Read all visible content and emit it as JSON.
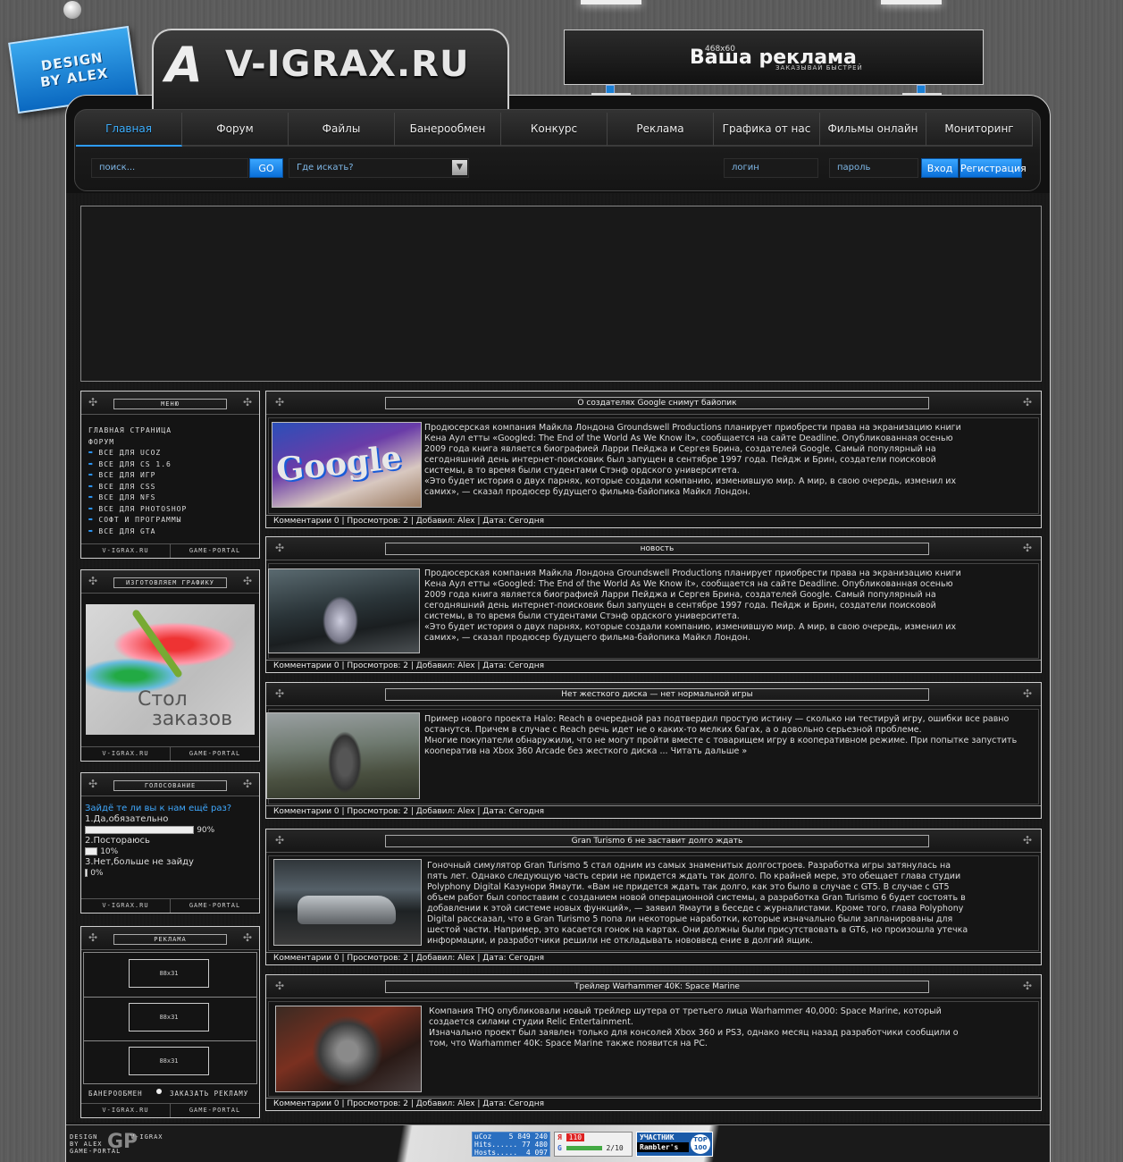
{
  "badge": {
    "line1": "DESIGN",
    "line2": "BY ALEX"
  },
  "logo": {
    "mark": "A",
    "text": "V-IGRAX.RU"
  },
  "top_ad": {
    "size": "468x60",
    "title": "Ваша реклама",
    "subtitle": "ЗАКАЗЫВАЙ БЫСТРЕЙ"
  },
  "nav": [
    "Главная",
    "Форум",
    "Файлы",
    "Банерообмен",
    "Конкурс",
    "Реклама",
    "Графика от нас",
    "Фильмы онлайн",
    "Мониторинг"
  ],
  "search": {
    "placeholder": "поиск...",
    "go": "GO",
    "where": "Где искать?"
  },
  "auth": {
    "login": "логин",
    "password": "пароль",
    "enter": "Вход",
    "register": "Регистрация"
  },
  "sidebar": {
    "footer_left": "V-IGRAX.RU",
    "footer_right": "GAME-PORTAL",
    "menu": {
      "title": "меню",
      "items": [
        "главная страница",
        "форум"
      ],
      "sub": [
        "все для ucoz",
        "все для cs 1.6",
        "все для игр",
        "все для css",
        "все для nfs",
        "все для photoshop",
        "софт и программы",
        "все для gta"
      ]
    },
    "graphics": {
      "title": "изготовляем графику",
      "image_text_1": "Стол",
      "image_text_2": "заказов"
    },
    "poll": {
      "title": "голосование",
      "question": "Зайдё те ли вы к нам ещё раз?",
      "options": [
        {
          "label": "1.Да,обязательно",
          "pct": "90%",
          "value": 90
        },
        {
          "label": "2.Постораюсь",
          "pct": "10%",
          "value": 10
        },
        {
          "label": "3.Нет,больше не зайду",
          "pct": "0%",
          "value": 0
        }
      ]
    },
    "ads": {
      "title": "реклама",
      "slots": [
        "88x31",
        "88x31",
        "88x31"
      ],
      "bottom_left": "Банерообмен",
      "bottom_right": "Заказать рекламу"
    }
  },
  "news": [
    {
      "title": "О создателях Google снимут байопик",
      "text": "Продюсерская компания Майкла Лондона Groundswell Productions планирует приобрести права на экранизацию книги Кена Аул етты «Googled: The End of the World As We Know it», сообщается на сайте Deadline. Опубликованная осенью 2009 года книга является биографией Ларри Пейджа и Сергея Брина, создателей Google. Самый популярный на сегодняшний день интернет-поисковик был запущен в сентябре 1997 года. Пейдж и Брин, создатели поисковой системы, в то время были студентами Стэнф ордского университета.\n«Это будет история о двух парнях, которые создали компанию, изменившую мир. А мир, в свою очередь, изменил их самих», — сказал продюсер будущего фильма-байопика Майкл Лондон.",
      "meta": "Комментарии 0 | Просмотров: 2 | Добавил: Alex | Дата: Сегодня",
      "img": "Google"
    },
    {
      "title": "новость",
      "text": "Продюсерская компания Майкла Лондона Groundswell Productions планирует приобрести права на экранизацию книги Кена Аул етты «Googled: The End of the World As We Know it», сообщается на сайте Deadline. Опубликованная осенью 2009 года книга является биографией Ларри Пейджа и Сергея Брина, создателей Google. Самый популярный на сегодняшний день интернет-поисковик был запущен в сентябре 1997 года. Пейдж и Брин, создатели поисковой системы, в то время были студентами Стэнф ордского университета.\n«Это будет история о двух парнях, которые создали компанию, изменившую мир. А мир, в свою очередь, изменил их самих», — сказал продюсер будущего фильма-байопика Майкл Лондон.",
      "meta": "Комментарии 0 | Просмотров: 2 | Добавил: Alex | Дата: Сегодня",
      "img": ""
    },
    {
      "title": "Нет жесткого диска — нет нормальной игры",
      "text": "Пример нового проекта Halo: Reach в очередной раз подтвердил простую истину — сколько ни тестируй игру, ошибки все равно останутся. Причем в случае с Reach речь идет не о каких-то мелких багах, а о довольно серьезной проблеме.\nМногие покупатели обнаружили, что не могут пройти вместе с товарищем игру в кооперативном режиме. При попытке запустить кооператив на Xbox 360 Arcade без жесткого диска ... Читать дальше »",
      "meta": "Комментарии 0 | Просмотров: 2 | Добавил: Alex | Дата: Сегодня",
      "img": ""
    },
    {
      "title": "Gran Turismo 6 не заставит долго ждать",
      "text": "Гоночный симулятор Gran Turismo 5 стал одним из самых знаменитых долгостроев. Разработка игры затянулась на пять лет. Однако следующую часть серии не придется ждать так долго. По крайней мере, это обещает глава студии Polyphony Digital Казунори Ямаути. «Вам не придется ждать так долго, как это было в случае с GT5. В случае с GT5 объем работ был сопоставим с созданием новой операционной системы, а разработка Gran Turismo 6 будет состоять в добавлении к этой системе новых функций», — заявил Ямаути в беседе с журналистами. Кроме того, глава Polyphony Digital рассказал, что в Gran Turismo 5 попа ли некоторые наработки, которые изначально были запланированы для шестой части. Например, это касается гонок на картах. Они должны были присутствовать в GT6, но произошла утечка информации, и разработчики решили не откладывать нововвед ение в долгий ящик.",
      "meta": "Комментарии 0 | Просмотров: 2 | Добавил: Alex | Дата: Сегодня",
      "img": ""
    },
    {
      "title": "Трейлер Warhammer 40K: Space Marine",
      "text": "Компания THQ опубликовали новый трейлер шутера от третьего лица Warhammer 40,000: Space Marine, который создается силами студии Relic Entertainment.\nИзначально проект был заявлен только для консолей Xbox 360 и PS3, однако месяц назад разработчики сообщили о том, что Warhammer 40K: Space Marine также появится на PC.",
      "meta": "Комментарии 0 | Просмотров: 2 | Добавил: Alex | Дата: Сегодня",
      "img": ""
    }
  ],
  "footer": {
    "logo_l1": "DESIGN",
    "logo_l2": "BY ALEX",
    "logo_l3": "GAME-PORTAL",
    "logo_mark": "GP",
    "logo_r": "V-IGRAX",
    "ucoz": {
      "brand": "uCoz",
      "total": "5 849 240",
      "hits_label": "Hits......",
      "hits": "77 480",
      "hosts_label": "Hosts.....",
      "hosts": "4 097"
    },
    "yandex": {
      "letter": "Я",
      "cy": "110",
      "g": "G",
      "pr": "2/10"
    },
    "rambler": {
      "line1": "УЧАСТНИК",
      "line2": "Rambler's",
      "top": "TOP",
      "top2": "100"
    }
  },
  "colors": {
    "accent": "#2d9cff",
    "frame": "#cfcfcf"
  }
}
